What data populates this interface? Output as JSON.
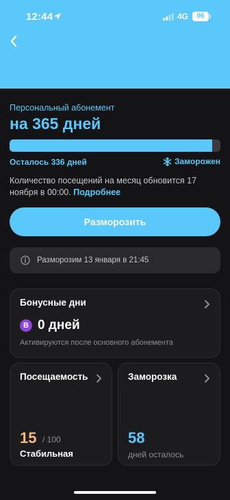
{
  "status_bar": {
    "time": "12:44",
    "network": "4G",
    "battery": "96"
  },
  "subscription": {
    "type_label": "Персональный абонемент",
    "title": "на 365 дней",
    "progress": 0.96,
    "remaining": "Осталось 336 дней",
    "frozen_label": "Заморожен",
    "visits_info": "Количество посещений на месяц обновится 17 ноября в 00:00.",
    "more_link": "Подробнее"
  },
  "unfreeze_button": "Разморозить",
  "notice": "Разморозим 13 января в 21:45",
  "bonus": {
    "title": "Бонусные дни",
    "badge": "B",
    "value": "0 дней",
    "note": "Активируются после основного абонемента"
  },
  "attendance": {
    "title": "Посещаемость",
    "value": "15",
    "max": "/ 100",
    "status": "Стабильная"
  },
  "freeze": {
    "title": "Заморозка",
    "value": "58",
    "note": "дней осталось"
  },
  "colors": {
    "accent": "#5ac8fa",
    "background": "#141416",
    "card": "#1c1c1e",
    "attendance_value": "#f5b87a",
    "bonus_badge": "#8e44dd"
  },
  "icons": {
    "back": "chevron-left-icon",
    "location": "location-arrow-icon",
    "signal": "signal-bars-icon",
    "snowflake": "snowflake-icon",
    "info": "info-circle-icon",
    "chevron": "chevron-right-icon"
  }
}
